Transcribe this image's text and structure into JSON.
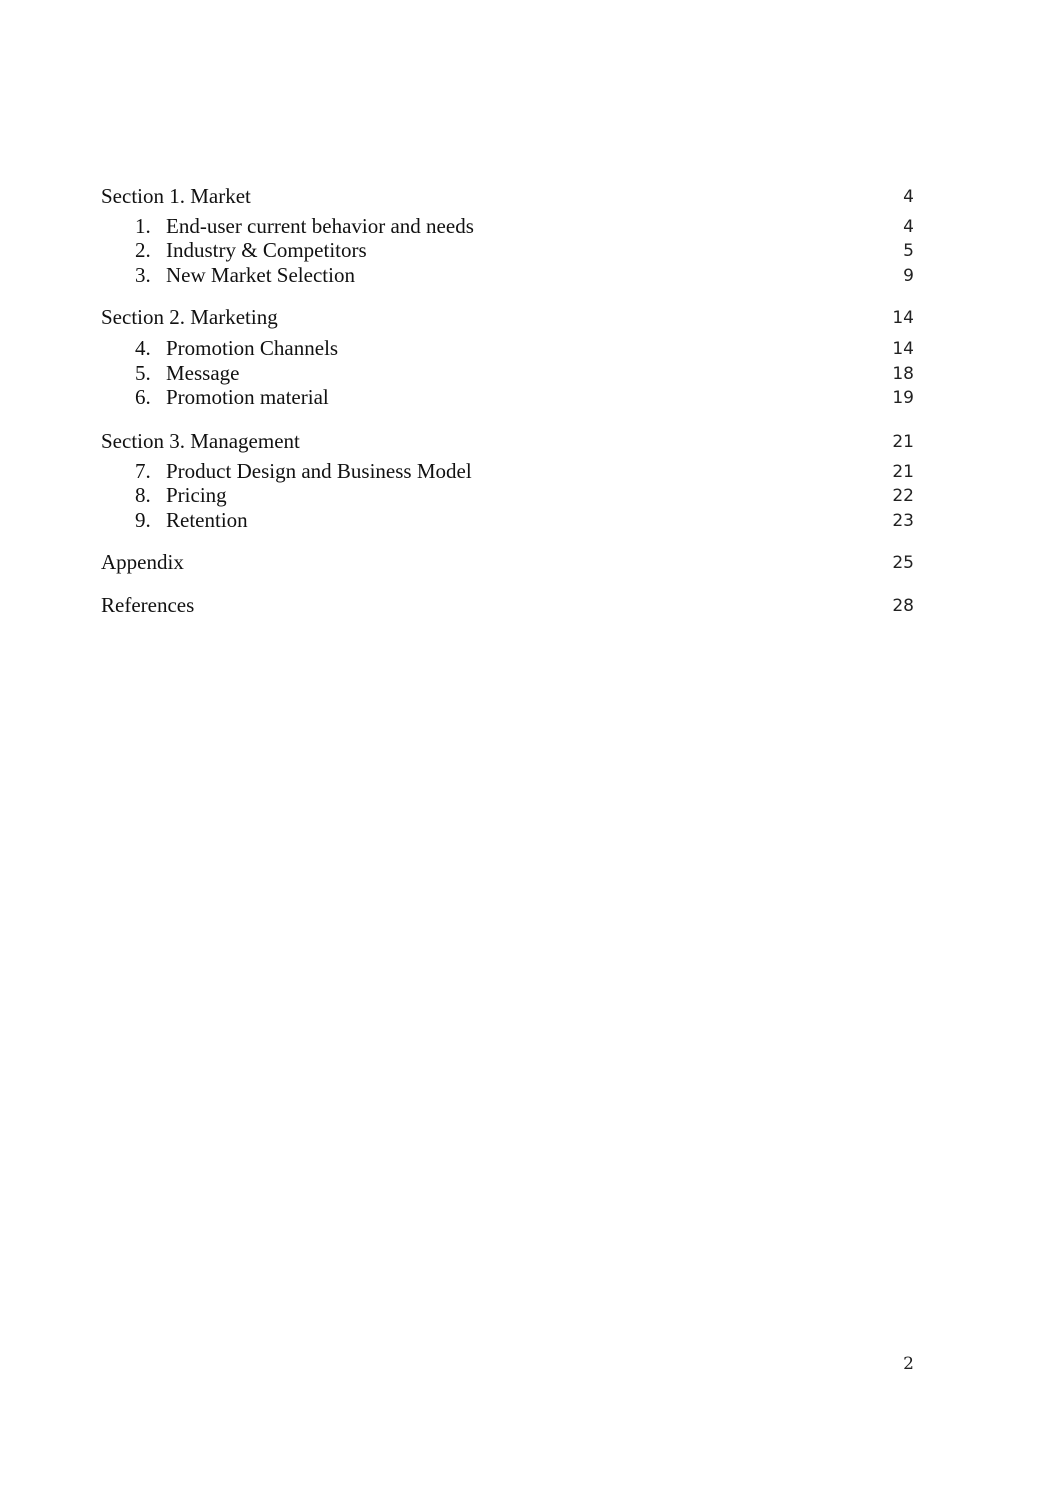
{
  "toc": {
    "sections": [
      {
        "title": "Section 1. Market",
        "page": "4",
        "items": [
          {
            "num": "1.",
            "title": "End-user current behavior and needs",
            "page": "4"
          },
          {
            "num": "2.",
            "title": "Industry & Competitors",
            "page": "5"
          },
          {
            "num": "3.",
            "title": "New Market Selection",
            "page": "9"
          }
        ]
      },
      {
        "title": "Section 2. Marketing",
        "page": "14",
        "items": [
          {
            "num": "4.",
            "title": "Promotion Channels",
            "page": "14"
          },
          {
            "num": "5.",
            "title": "Message",
            "page": "18"
          },
          {
            "num": "6.",
            "title": "Promotion material",
            "page": "19"
          }
        ]
      },
      {
        "title": "Section 3. Management",
        "page": "21",
        "items": [
          {
            "num": "7.",
            "title": "Product Design and Business Model",
            "page": "21"
          },
          {
            "num": "8.",
            "title": "Pricing",
            "page": "22"
          },
          {
            "num": "9.",
            "title": "Retention",
            "page": "23"
          }
        ]
      }
    ],
    "appendix": {
      "title": "Appendix",
      "page": "25"
    },
    "references": {
      "title": "References",
      "page": "28"
    }
  },
  "footer": {
    "page_number": "2"
  }
}
